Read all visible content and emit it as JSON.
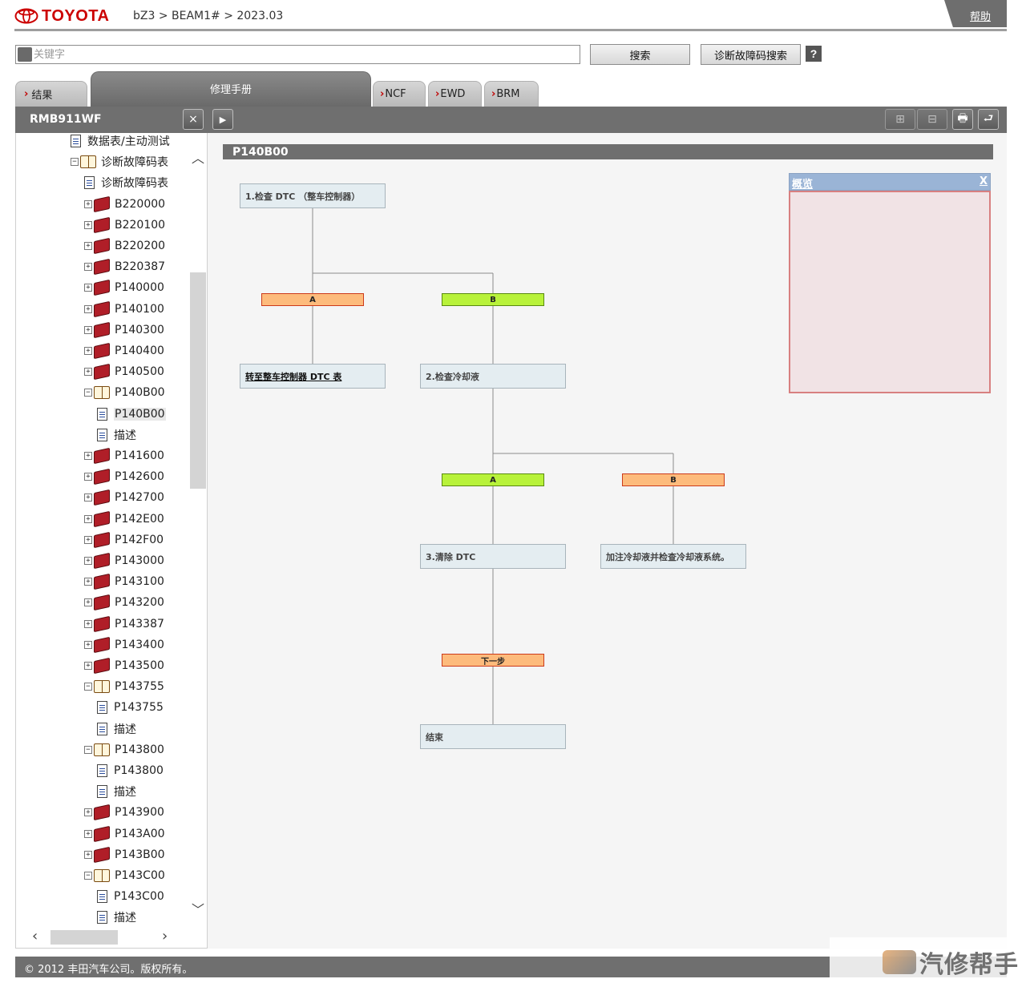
{
  "header": {
    "brand": "TOYOTA",
    "breadcrumb": "bZ3 > BEAM1# > 2023.03",
    "help": "帮助"
  },
  "search": {
    "placeholder": "关键字",
    "value": "",
    "search_button": "搜索",
    "dtc_search_button": "诊断故障码搜索",
    "help_button": "?"
  },
  "tabs": {
    "results": "结果",
    "manual": "修理手册",
    "ncf": "NCF",
    "ewd": "EWD",
    "brm": "BRM"
  },
  "toolbar": {
    "panel_title": "RMB911WF",
    "close": "×",
    "toggle": "▶",
    "expand": "⊞",
    "collapse": "⊟",
    "print": "🖶",
    "back": "⮐"
  },
  "tree": [
    {
      "label": "数据表/主动测试",
      "type": "doc",
      "level": 3,
      "pm": ""
    },
    {
      "label": "诊断故障码表",
      "type": "book-open",
      "level": 3,
      "pm": "−"
    },
    {
      "label": "诊断故障码表",
      "type": "doc",
      "level": 4,
      "pm": ""
    },
    {
      "label": "B220000",
      "type": "book",
      "level": 4,
      "pm": "+"
    },
    {
      "label": "B220100",
      "type": "book",
      "level": 4,
      "pm": "+"
    },
    {
      "label": "B220200",
      "type": "book",
      "level": 4,
      "pm": "+"
    },
    {
      "label": "B220387",
      "type": "book",
      "level": 4,
      "pm": "+"
    },
    {
      "label": "P140000",
      "type": "book",
      "level": 4,
      "pm": "+"
    },
    {
      "label": "P140100",
      "type": "book",
      "level": 4,
      "pm": "+"
    },
    {
      "label": "P140300",
      "type": "book",
      "level": 4,
      "pm": "+"
    },
    {
      "label": "P140400",
      "type": "book",
      "level": 4,
      "pm": "+"
    },
    {
      "label": "P140500",
      "type": "book",
      "level": 4,
      "pm": "+"
    },
    {
      "label": "P140B00",
      "type": "book-open",
      "level": 4,
      "pm": "−"
    },
    {
      "label": "P140B00",
      "type": "doc",
      "level": 5,
      "pm": "",
      "selected": true
    },
    {
      "label": "描述",
      "type": "doc",
      "level": 5,
      "pm": ""
    },
    {
      "label": "P141600",
      "type": "book",
      "level": 4,
      "pm": "+"
    },
    {
      "label": "P142600",
      "type": "book",
      "level": 4,
      "pm": "+"
    },
    {
      "label": "P142700",
      "type": "book",
      "level": 4,
      "pm": "+"
    },
    {
      "label": "P142E00",
      "type": "book",
      "level": 4,
      "pm": "+"
    },
    {
      "label": "P142F00",
      "type": "book",
      "level": 4,
      "pm": "+"
    },
    {
      "label": "P143000",
      "type": "book",
      "level": 4,
      "pm": "+"
    },
    {
      "label": "P143100",
      "type": "book",
      "level": 4,
      "pm": "+"
    },
    {
      "label": "P143200",
      "type": "book",
      "level": 4,
      "pm": "+"
    },
    {
      "label": "P143387",
      "type": "book",
      "level": 4,
      "pm": "+"
    },
    {
      "label": "P143400",
      "type": "book",
      "level": 4,
      "pm": "+"
    },
    {
      "label": "P143500",
      "type": "book",
      "level": 4,
      "pm": "+"
    },
    {
      "label": "P143755",
      "type": "book-open",
      "level": 4,
      "pm": "−"
    },
    {
      "label": "P143755",
      "type": "doc",
      "level": 5,
      "pm": ""
    },
    {
      "label": "描述",
      "type": "doc",
      "level": 5,
      "pm": ""
    },
    {
      "label": "P143800",
      "type": "book-open",
      "level": 4,
      "pm": "−"
    },
    {
      "label": "P143800",
      "type": "doc",
      "level": 5,
      "pm": ""
    },
    {
      "label": "描述",
      "type": "doc",
      "level": 5,
      "pm": ""
    },
    {
      "label": "P143900",
      "type": "book",
      "level": 4,
      "pm": "+"
    },
    {
      "label": "P143A00",
      "type": "book",
      "level": 4,
      "pm": "+"
    },
    {
      "label": "P143B00",
      "type": "book",
      "level": 4,
      "pm": "+"
    },
    {
      "label": "P143C00",
      "type": "book-open",
      "level": 4,
      "pm": "−"
    },
    {
      "label": "P143C00",
      "type": "doc",
      "level": 5,
      "pm": ""
    },
    {
      "label": "描述",
      "type": "doc",
      "level": 5,
      "pm": ""
    }
  ],
  "content": {
    "title": "P140B00",
    "flow": {
      "step1": "1.检查 DTC （整车控制器）",
      "a1": "A",
      "b1": "B",
      "goto_ecu": "转至整车控制器 DTC 表",
      "step2": "2.检查冷却液",
      "a2": "A",
      "b2": "B",
      "step3": "3.清除 DTC",
      "refill": "加注冷却液并检查冷却液系统。",
      "next": "下一步",
      "end": "结束"
    },
    "overview": {
      "title": "概览",
      "close": "X"
    }
  },
  "footer": {
    "copyright": "© 2012 丰田汽车公司。版权所有。",
    "watermark": "汽修帮手"
  }
}
